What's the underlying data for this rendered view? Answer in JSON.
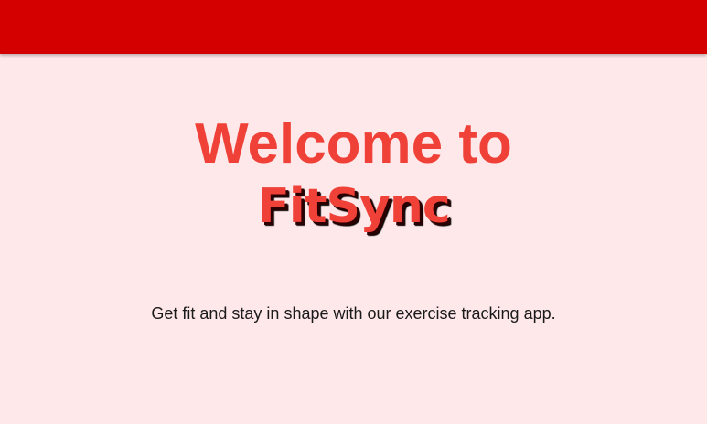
{
  "colors": {
    "header_bar": "#d40000",
    "background": "#ffe8ea",
    "accent": "#ef4138",
    "text": "#1a1a1a"
  },
  "hero": {
    "welcome_line": "Welcome to",
    "brand_name": "FitSync",
    "tagline": "Get fit and stay in shape with our exercise tracking app."
  }
}
